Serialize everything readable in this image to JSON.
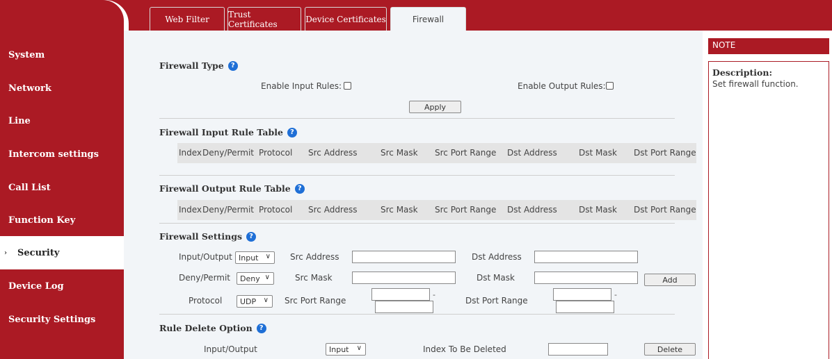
{
  "tabs": [
    {
      "label": "Web Filter",
      "active": false
    },
    {
      "label": "Trust Certificates",
      "active": false
    },
    {
      "label": "Device Certificates",
      "active": false
    },
    {
      "label": "Firewall",
      "active": true
    }
  ],
  "sidebar": {
    "items": [
      {
        "label": "System"
      },
      {
        "label": "Network"
      },
      {
        "label": "Line"
      },
      {
        "label": "Intercom settings"
      },
      {
        "label": "Call List"
      },
      {
        "label": "Function Key"
      },
      {
        "label": "Security",
        "active": true
      },
      {
        "label": "Device Log"
      },
      {
        "label": "Security Settings"
      }
    ]
  },
  "firewall_type": {
    "title": "Firewall Type",
    "enable_input_label": "Enable Input Rules:",
    "enable_output_label": "Enable Output Rules:",
    "apply_label": "Apply"
  },
  "input_table": {
    "title": "Firewall Input Rule Table",
    "columns": [
      "Index",
      "Deny/Permit",
      "Protocol",
      "Src Address",
      "Src Mask",
      "Src Port Range",
      "Dst Address",
      "Dst Mask",
      "Dst Port Range"
    ]
  },
  "output_table": {
    "title": "Firewall Output Rule Table",
    "columns": [
      "Index",
      "Deny/Permit",
      "Protocol",
      "Src Address",
      "Src Mask",
      "Src Port Range",
      "Dst Address",
      "Dst Mask",
      "Dst Port Range"
    ]
  },
  "settings": {
    "title": "Firewall Settings",
    "io_label": "Input/Output",
    "io_value": "Input",
    "src_address_label": "Src Address",
    "dst_address_label": "Dst Address",
    "deny_label": "Deny/Permit",
    "deny_value": "Deny",
    "src_mask_label": "Src Mask",
    "dst_mask_label": "Dst Mask",
    "add_label": "Add",
    "protocol_label": "Protocol",
    "protocol_value": "UDP",
    "src_port_label": "Src Port Range",
    "dst_port_label": "Dst Port Range",
    "dash": "-"
  },
  "delete": {
    "title": "Rule Delete Option",
    "io_label": "Input/Output",
    "io_value": "Input",
    "index_label": "Index To Be Deleted",
    "delete_label": "Delete"
  },
  "note": {
    "header": "NOTE",
    "title": "Description:",
    "text": "Set firewall function."
  },
  "help_glyph": "?"
}
